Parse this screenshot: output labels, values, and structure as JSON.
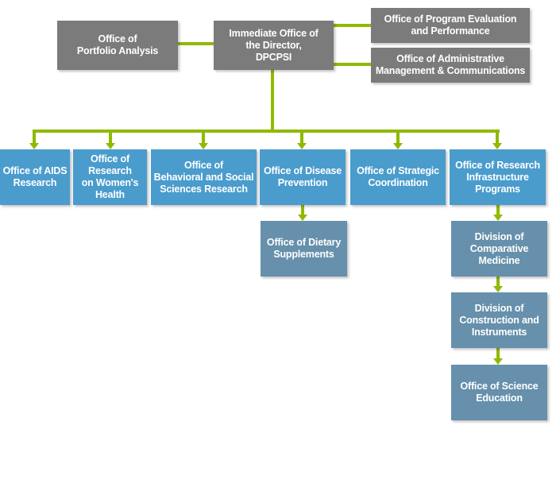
{
  "colors": {
    "connector": "#8fba00",
    "top_level": "#7b7b7b",
    "offices": "#4a9ccd",
    "sub_units": "#6690ab"
  },
  "top": {
    "portfolio": "Office of\nPortfolio Analysis",
    "director": "Immediate Office of\nthe Director,\nDPCPSI",
    "program_eval": "Office of Program Evaluation\nand Performance",
    "admin": "Office of Administrative\nManagement & Communications"
  },
  "offices": [
    "Office of AIDS\nResearch",
    "Office of\nResearch\non Women's\nHealth",
    "Office of\nBehavioral and Social\nSciences Research",
    "Office of Disease\nPrevention",
    "Office of Strategic\nCoordination",
    "Office of Research\nInfrastructure\nPrograms"
  ],
  "sub_units": {
    "dietary": "Office of Dietary\nSupplements",
    "comparative": "Division of\nComparative\nMedicine",
    "construction": "Division of\nConstruction and\nInstruments",
    "science_ed": "Office of Science\nEducation"
  }
}
